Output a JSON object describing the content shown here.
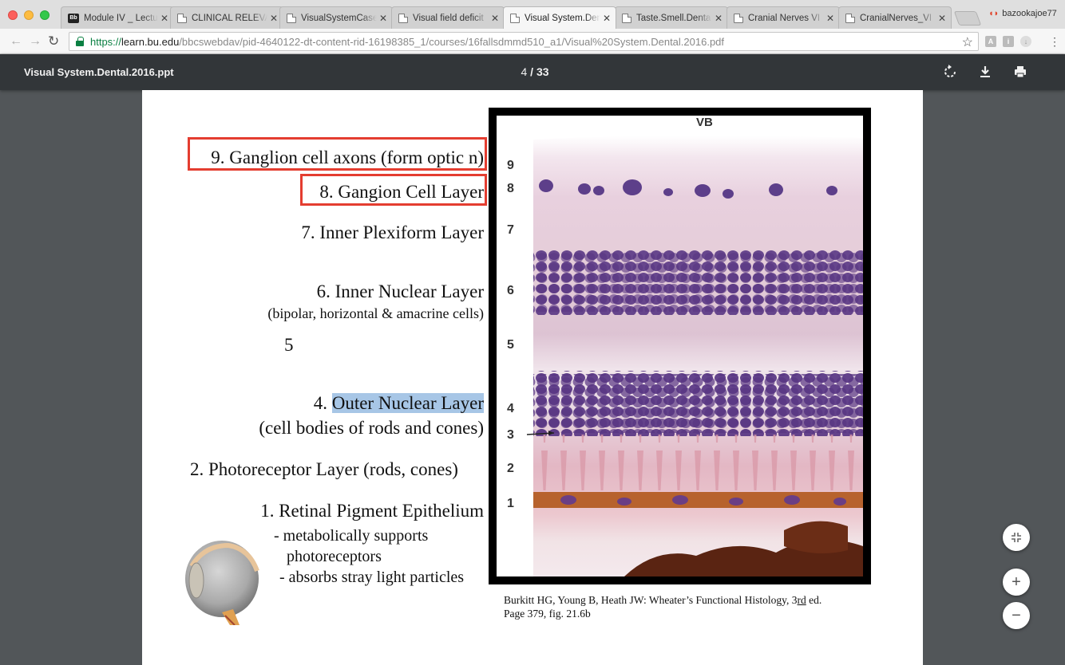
{
  "browser": {
    "tabs": [
      {
        "label": "Module IV _ Lectu",
        "favicon": "blackboard-icon"
      },
      {
        "label": "CLINICAL RELEVA",
        "favicon": "document-icon"
      },
      {
        "label": "VisualSystemCase",
        "favicon": "document-icon"
      },
      {
        "label": "Visual field deficit",
        "favicon": "document-icon"
      },
      {
        "label": "Visual System.Den",
        "favicon": "document-icon",
        "active": true
      },
      {
        "label": "Taste.Smell.Denta",
        "favicon": "document-icon"
      },
      {
        "label": "Cranial Nerves VI",
        "favicon": "document-icon"
      },
      {
        "label": "CranialNerves_VI",
        "favicon": "document-icon"
      }
    ],
    "profile": "bazookajoe77",
    "url": {
      "scheme": "https://",
      "host": "learn.bu.edu",
      "path": "/bbcswebdav/pid-4640122-dt-content-rid-16198385_1/courses/16fallsdmmd510_a1/Visual%20System.Dental.2016.pdf"
    }
  },
  "pdf_viewer": {
    "title": "Visual System.Dental.2016.ppt",
    "current_page": "4",
    "separator": "/",
    "total_pages": "33"
  },
  "slide": {
    "layers": {
      "l9": "9. Ganglion cell axons (form optic n)",
      "l8": "8. Gangion Cell Layer",
      "l7": "7. Inner Plexiform Layer",
      "l6": "6. Inner Nuclear Layer",
      "l6_sub": "(bipolar, horizontal & amacrine cells)",
      "l5": "5",
      "l4_prefix": "4. ",
      "l4_highlight": "Outer Nuclear Layer",
      "l4_sub": "(cell bodies of rods and cones)",
      "l2": "2. Photoreceptor Layer (rods, cones)",
      "l1": "1. Retinal Pigment Epithelium",
      "l1_b1": "- metabolically supports",
      "l1_b1b": "photoreceptors",
      "l1_b2": "- absorbs stray light particles"
    },
    "micrograph": {
      "label": "VB",
      "numbers": [
        "9",
        "8",
        "7",
        "6",
        "5",
        "4",
        "3",
        "2",
        "1"
      ]
    },
    "caption": {
      "line1a": "Burkitt HG, Young B, Heath JW: Wheater",
      "apos": "’",
      "line1b": "s Functional Histology, 3",
      "line1c": "rd",
      "line1d": " ed.",
      "line2": "Page 379, fig. 21.6b"
    }
  },
  "colors": {
    "highlight_box": "#e43d30",
    "selection": "#a7c6e6",
    "viewer_bar": "#323639"
  }
}
